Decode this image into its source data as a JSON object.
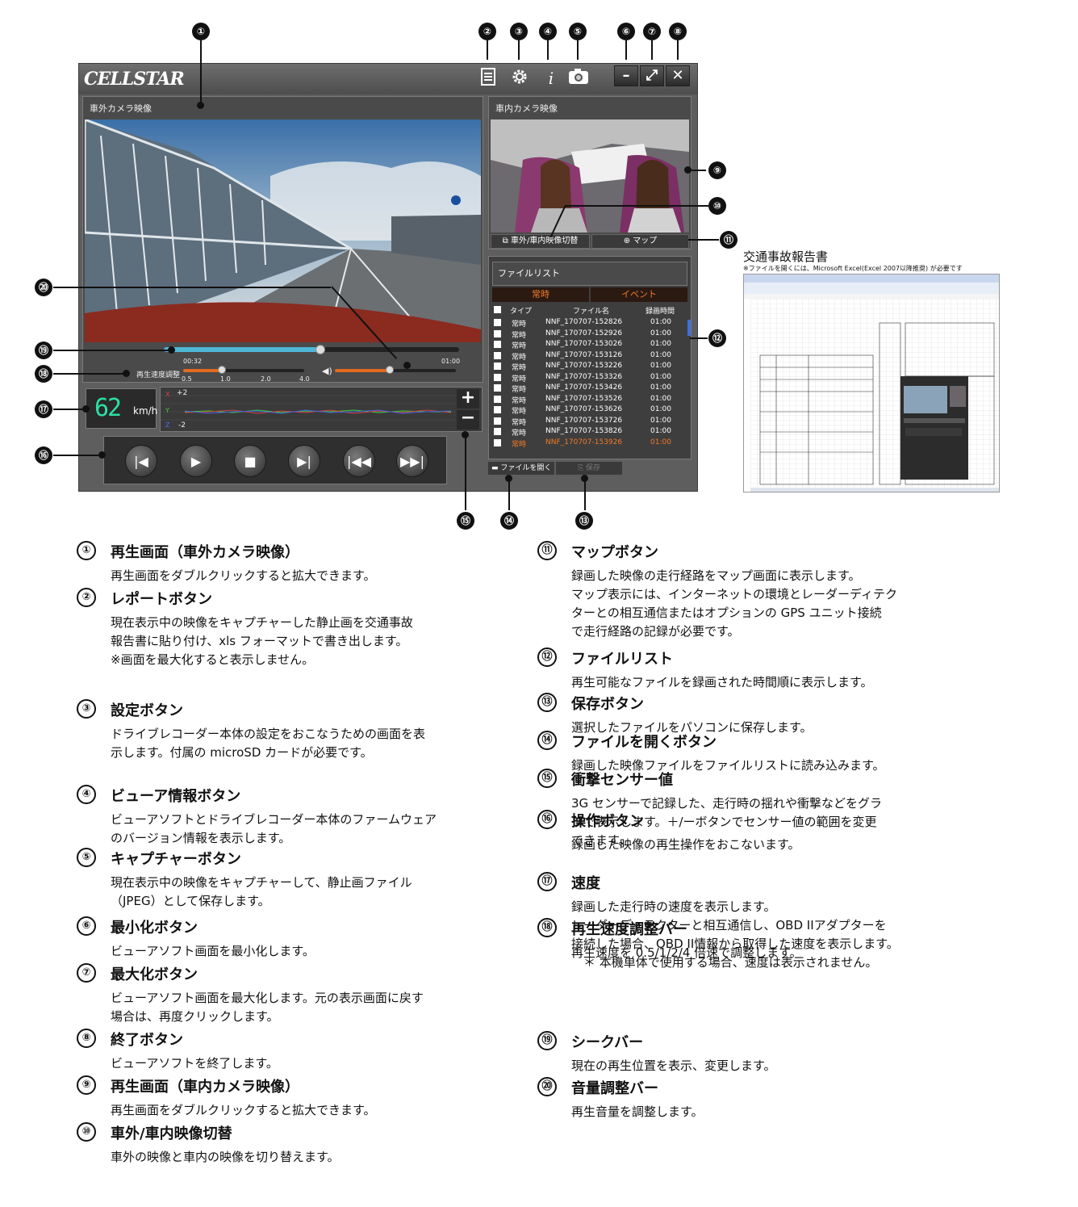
{
  "app": {
    "logo": "CELLSTAR",
    "outside_panel_title": "車外カメラ映像",
    "inside_panel_title": "車内カメラ映像",
    "switch_button_label": "車外/車内映像切替",
    "map_button_label": "マップ",
    "file_list_title": "ファイルリスト",
    "tabs": [
      "常時",
      "イベント"
    ],
    "file_columns": [
      "タイプ",
      "ファイル名",
      "録画時間"
    ],
    "files": [
      {
        "type": "常時",
        "name": "NNF_170707-152826",
        "time": "01:00"
      },
      {
        "type": "常時",
        "name": "NNF_170707-152926",
        "time": "01:00"
      },
      {
        "type": "常時",
        "name": "NNF_170707-153026",
        "time": "01:00"
      },
      {
        "type": "常時",
        "name": "NNF_170707-153126",
        "time": "01:00"
      },
      {
        "type": "常時",
        "name": "NNF_170707-153226",
        "time": "01:00"
      },
      {
        "type": "常時",
        "name": "NNF_170707-153326",
        "time": "01:00"
      },
      {
        "type": "常時",
        "name": "NNF_170707-153426",
        "time": "01:00"
      },
      {
        "type": "常時",
        "name": "NNF_170707-153526",
        "time": "01:00"
      },
      {
        "type": "常時",
        "name": "NNF_170707-153626",
        "time": "01:00"
      },
      {
        "type": "常時",
        "name": "NNF_170707-153726",
        "time": "01:00"
      },
      {
        "type": "常時",
        "name": "NNF_170707-153826",
        "time": "01:00"
      },
      {
        "type": "常時",
        "name": "NNF_170707-153926",
        "time": "01:00"
      }
    ],
    "open_file_label": "ファイルを開く",
    "save_label": "保存",
    "seek_current": "00:32",
    "seek_total": "01:00",
    "seek_fraction": 0.53,
    "speed_label": "再生速度調整",
    "speed_ticks": [
      "0.5",
      "1.0",
      "2.0",
      "4.0"
    ],
    "volume_fraction": 0.45,
    "speed_value": "62",
    "speed_unit": "km/h",
    "graph_top": "+2",
    "graph_bottom": "-2",
    "graph_axes": [
      "X",
      "Y",
      "Z"
    ]
  },
  "callout_numbers": [
    "①",
    "②",
    "③",
    "④",
    "⑤",
    "⑥",
    "⑦",
    "⑧",
    "⑨",
    "⑩",
    "⑪",
    "⑫",
    "⑬",
    "⑭",
    "⑮",
    "⑯",
    "⑰",
    "⑱",
    "⑲",
    "⑳"
  ],
  "report": {
    "title": "交通事故報告書",
    "note": "※ファイルを開くには、Microsoft Excel(Excel 2007以降推奨) が必要です"
  },
  "items": [
    {
      "num": "①",
      "title": "再生画面（車外カメラ映像）",
      "desc": "再生画面をダブルクリックすると拡大できます。"
    },
    {
      "num": "②",
      "title": "レポートボタン",
      "desc": "現在表示中の映像をキャプチャーした静止画を交通事故\n報告書に貼り付け、xls フォーマットで書き出します。\n※画面を最大化すると表示しません。"
    },
    {
      "num": "③",
      "title": "設定ボタン",
      "desc": "ドライブレコーダー本体の設定をおこなうための画面を表\n示します。付属の microSD カードが必要です。"
    },
    {
      "num": "④",
      "title": "ビューア情報ボタン",
      "desc": "ビューアソフトとドライブレコーダー本体のファームウェア\nのバージョン情報を表示します。"
    },
    {
      "num": "⑤",
      "title": "キャプチャーボタン",
      "desc": "現在表示中の映像をキャプチャーして、静止画ファイル\n（JPEG）として保存します。"
    },
    {
      "num": "⑥",
      "title": "最小化ボタン",
      "desc": "ビューアソフト画面を最小化します。"
    },
    {
      "num": "⑦",
      "title": "最大化ボタン",
      "desc": "ビューアソフト画面を最大化します。元の表示画面に戻す\n場合は、再度クリックします。"
    },
    {
      "num": "⑧",
      "title": "終了ボタン",
      "desc": "ビューアソフトを終了します。"
    },
    {
      "num": "⑨",
      "title": "再生画面（車内カメラ映像）",
      "desc": "再生画面をダブルクリックすると拡大できます。"
    },
    {
      "num": "⑩",
      "title": "車外/車内映像切替",
      "desc": "車外の映像と車内の映像を切り替えます。"
    },
    {
      "num": "⑪",
      "title": "マップボタン",
      "desc": "録画した映像の走行経路をマップ画面に表示します。\nマップ表示には、インターネットの環境とレーダーディテク\nターとの相互通信またはオプションの GPS ユニット接続\nで走行経路の記録が必要です。"
    },
    {
      "num": "⑫",
      "title": "ファイルリスト",
      "desc": "再生可能なファイルを録画された時間順に表示します。"
    },
    {
      "num": "⑬",
      "title": "保存ボタン",
      "desc": "選択したファイルをパソコンに保存します。"
    },
    {
      "num": "⑭",
      "title": "ファイルを開くボタン",
      "desc": "録画した映像ファイルをファイルリストに読み込みます。"
    },
    {
      "num": "⑮",
      "title": "衝撃センサー値",
      "desc": "3G センサーで記録した、走行時の揺れや衝撃などをグラ\nフで表示します。＋/ーボタンでセンサー値の範囲を変更\nできます。"
    },
    {
      "num": "⑯",
      "title": "操作ボタン",
      "desc": "録画した映像の再生操作をおこないます。"
    },
    {
      "num": "⑰",
      "title": "速度",
      "desc": "録画した走行時の速度を表示します。\nレーダーディテクターと相互通信し、OBD IIアダプターを\n接続した場合、OBD II情報から取得した速度を表示します。\n　＊ 本機単体で使用する場合、速度は表示されません。"
    },
    {
      "num": "⑱",
      "title": "再生速度調整バー",
      "desc": "再生速度を 0.5/1/2/4 倍速で調整します。"
    },
    {
      "num": "⑲",
      "title": "シークバー",
      "desc": "現在の再生位置を表示、変更します。"
    },
    {
      "num": "⑳",
      "title": "音量調整バー",
      "desc": "再生音量を調整します。"
    }
  ]
}
